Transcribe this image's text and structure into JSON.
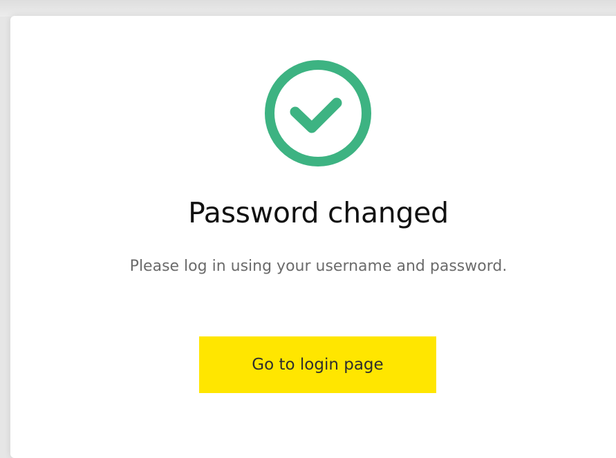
{
  "dialog": {
    "title": "Password changed",
    "message": "Please log in using your username and password.",
    "button_label": "Go to login page",
    "icon": "check-circle-icon"
  },
  "colors": {
    "accent_green": "#3db382",
    "button_yellow": "#ffe600",
    "title_text": "#111111",
    "message_text": "#6b6b6b",
    "background": "#e6e6e6",
    "card": "#ffffff"
  }
}
